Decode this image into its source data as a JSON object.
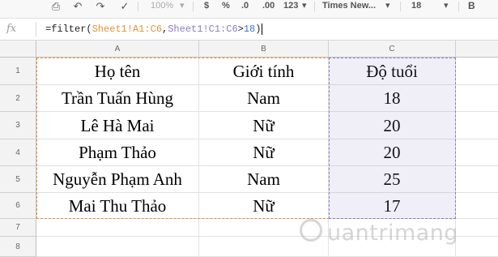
{
  "toolbar": {
    "zoom": "100%",
    "currency": "$",
    "percent": "%",
    "dec_decrease": ".0",
    "dec_increase": ".00",
    "more_formats": "123",
    "font_name": "Times New...",
    "font_size": "18",
    "bold": "B",
    "icons": [
      "print-icon",
      "undo-icon",
      "redo-icon",
      "paint-format-icon"
    ]
  },
  "formula_bar": {
    "fx_label": "fx",
    "prefix": "=filter(",
    "range1": "Sheet1!A1:C6",
    "comma": ",",
    "range2": "Sheet1!C1:C6",
    "op": ">",
    "number": "18",
    "suffix": ")"
  },
  "grid": {
    "columns": [
      "A",
      "B",
      "C"
    ],
    "row_numbers": [
      "1",
      "2",
      "3",
      "4",
      "5",
      "6",
      "7",
      "8"
    ],
    "headers": [
      "Họ tên",
      "Giới tính",
      "Độ tuổi"
    ],
    "rows": [
      [
        "Trần Tuấn Hùng",
        "Nam",
        "18"
      ],
      [
        "Lê Hà Mai",
        "Nữ",
        "20"
      ],
      [
        "Phạm Thảo",
        "Nữ",
        "20"
      ],
      [
        "Nguyễn Phạm Anh",
        "Nam",
        "25"
      ],
      [
        "Mai Thu Thảo",
        "Nữ",
        "17"
      ]
    ]
  },
  "watermark": {
    "text": "uantrimang"
  },
  "colors": {
    "range1": "#e69138",
    "range2": "#8e7cc3",
    "number": "#3c78d8",
    "header_bg": "#f3f3f3"
  }
}
